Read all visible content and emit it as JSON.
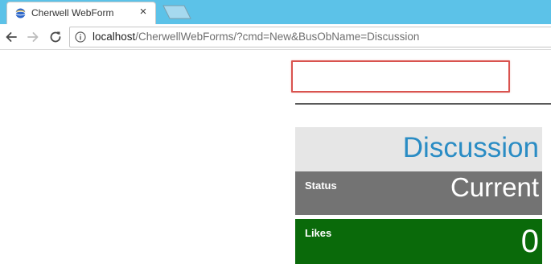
{
  "browser": {
    "tab": {
      "title": "Cherwell WebForm",
      "close_glyph": "×",
      "favicon": "globe-icon"
    },
    "new_tab_icon": "new-tab-icon",
    "toolbar": {
      "back_icon": "back-arrow-icon",
      "forward_icon": "forward-arrow-icon",
      "reload_icon": "reload-icon",
      "info_icon": "info-icon"
    },
    "address": {
      "host": "localhost",
      "rest": "/CherwellWebForms/?cmd=New&BusObName=Discussion"
    },
    "colors": {
      "tabstrip": "#5cc2e8",
      "highlight": "#d9534f"
    }
  },
  "form": {
    "title": "Discussion",
    "status": {
      "label": "Status",
      "value": "Current"
    },
    "likes": {
      "label": "Likes",
      "value": "0"
    },
    "colors": {
      "title_bg": "#e6e6e6",
      "title_text": "#2a8cc4",
      "status_bg": "#737373",
      "likes_bg": "#0a6a0a"
    }
  }
}
